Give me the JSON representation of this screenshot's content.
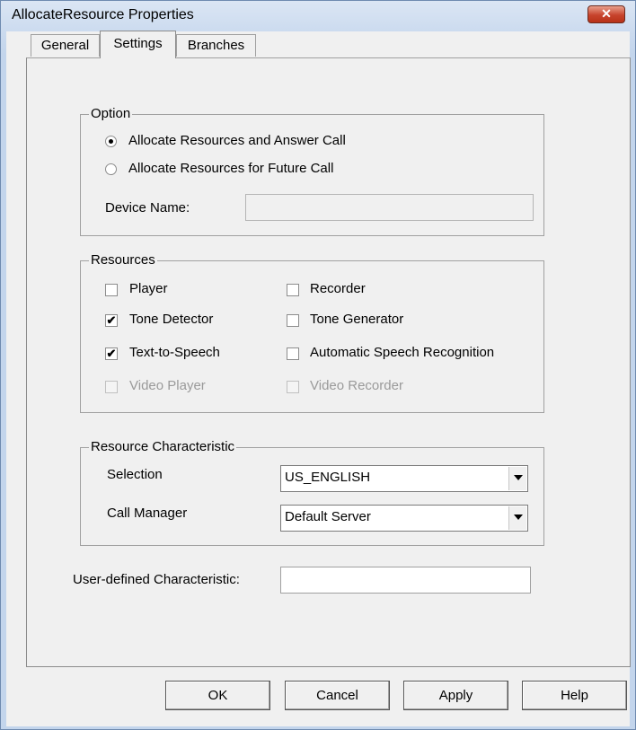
{
  "window": {
    "title": "AllocateResource Properties",
    "close_glyph": "✕"
  },
  "tabs": [
    {
      "label": "General",
      "active": false
    },
    {
      "label": "Settings",
      "active": true
    },
    {
      "label": "Branches",
      "active": false
    }
  ],
  "option_group": {
    "legend": "Option",
    "radio_answer_call": {
      "label": "Allocate Resources and Answer Call",
      "checked": true
    },
    "radio_future_call": {
      "label": "Allocate Resources for Future Call",
      "checked": false
    },
    "device_name_label": "Device Name:",
    "device_name_value": ""
  },
  "resources_group": {
    "legend": "Resources",
    "items": [
      {
        "label": "Player",
        "checked": false,
        "enabled": true
      },
      {
        "label": "Recorder",
        "checked": false,
        "enabled": true
      },
      {
        "label": "Tone Detector",
        "checked": true,
        "enabled": true
      },
      {
        "label": "Tone Generator",
        "checked": false,
        "enabled": true
      },
      {
        "label": "Text-to-Speech",
        "checked": true,
        "enabled": true
      },
      {
        "label": "Automatic Speech Recognition",
        "checked": false,
        "enabled": true
      },
      {
        "label": "Video Player",
        "checked": false,
        "enabled": false
      },
      {
        "label": "Video Recorder",
        "checked": false,
        "enabled": false
      }
    ],
    "check_glyph": "✔"
  },
  "characteristic_group": {
    "legend": "Resource Characteristic",
    "selection_label": "Selection",
    "selection_value": "US_ENGLISH",
    "call_manager_label": "Call Manager",
    "call_manager_value": "Default Server"
  },
  "user_defined": {
    "label": "User-defined Characteristic:",
    "value": ""
  },
  "buttons": {
    "ok": "OK",
    "cancel": "Cancel",
    "apply": "Apply",
    "help": "Help"
  }
}
